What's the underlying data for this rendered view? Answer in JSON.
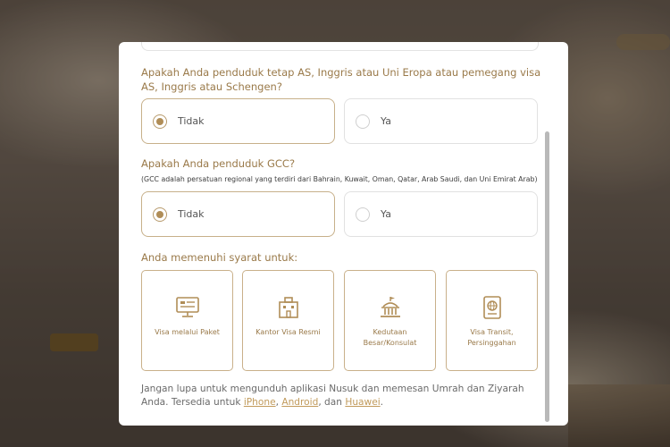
{
  "modal": {
    "q1": {
      "text": "Apakah Anda penduduk tetap AS, Inggris atau Uni Eropa atau pemegang visa AS, Inggris atau Schengen?",
      "options": [
        {
          "label": "Tidak",
          "selected": true
        },
        {
          "label": "Ya",
          "selected": false
        }
      ]
    },
    "q2": {
      "text": "Apakah Anda penduduk GCC?",
      "note": "(GCC adalah persatuan regional yang terdiri dari Bahrain, Kuwait, Oman, Qatar, Arab Saudi, dan Uni Emirat Arab)",
      "options": [
        {
          "label": "Tidak",
          "selected": true
        },
        {
          "label": "Ya",
          "selected": false
        }
      ]
    },
    "eligible": {
      "title": "Anda memenuhi syarat untuk:",
      "cards": [
        {
          "label": "Visa melalui Paket",
          "icon": "monitor-icon"
        },
        {
          "label": "Kantor Visa Resmi",
          "icon": "building-icon"
        },
        {
          "label": "Kedutaan Besar/Konsulat",
          "icon": "embassy-icon"
        },
        {
          "label": "Visa Transit, Persinggahan",
          "icon": "passport-icon"
        }
      ]
    },
    "footer": {
      "text_before": "Jangan lupa untuk mengunduh aplikasi Nusuk dan memesan Umrah dan Ziyarah Anda. Tersedia untuk ",
      "link_iphone": "iPhone",
      "sep1": ", ",
      "link_android": "Android",
      "sep2": ", dan ",
      "link_huawei": "Huawei",
      "text_after": "."
    }
  },
  "colors": {
    "accent": "#b08d57",
    "question_text": "#9a7a4a",
    "link": "#c19a5b"
  }
}
